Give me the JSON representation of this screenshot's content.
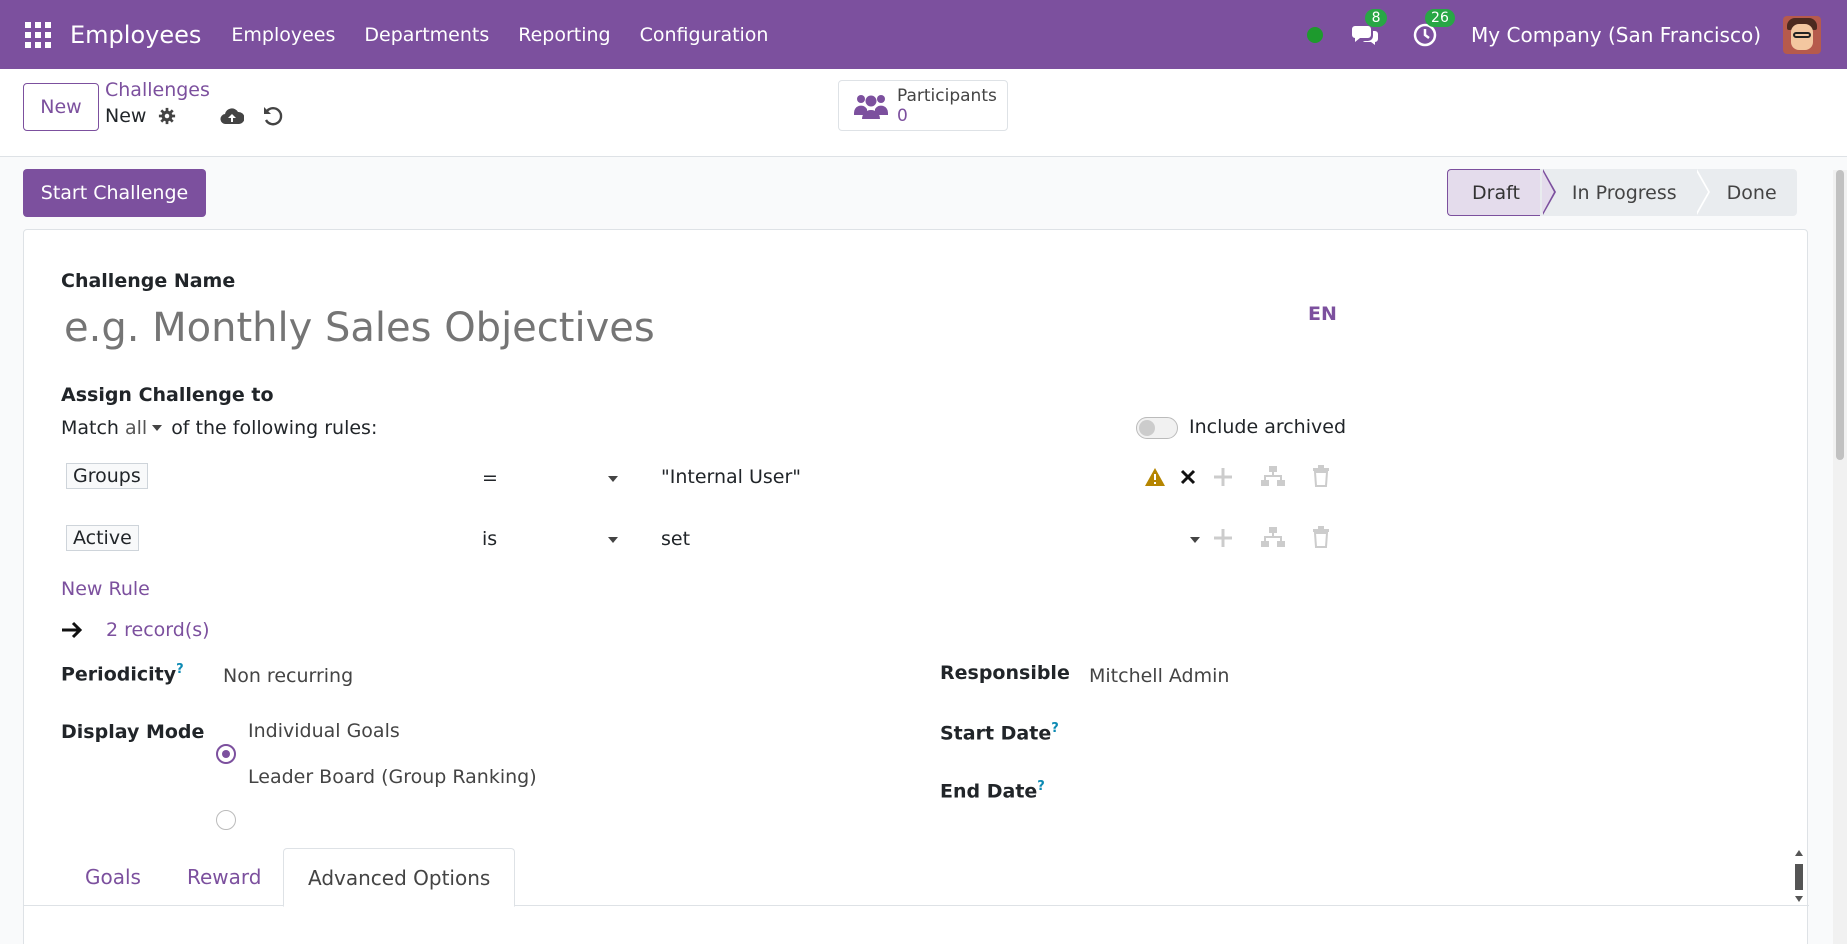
{
  "topbar": {
    "app_name": "Employees",
    "nav": [
      "Employees",
      "Departments",
      "Reporting",
      "Configuration"
    ],
    "messages_count": "8",
    "activities_count": "26",
    "company": "My Company (San Francisco)"
  },
  "control": {
    "new_label": "New",
    "breadcrumb_parent": "Challenges",
    "breadcrumb_current": "New",
    "participants_label": "Participants",
    "participants_count": "0"
  },
  "status": {
    "start_label": "Start Challenge",
    "stages": [
      "Draft",
      "In Progress",
      "Done"
    ],
    "active_stage": "Draft"
  },
  "form": {
    "challenge_name_label": "Challenge Name",
    "challenge_name_placeholder": "e.g. Monthly Sales Objectives",
    "lang": "EN",
    "assign_label": "Assign Challenge to",
    "match_prefix": "Match",
    "match_value": "all",
    "match_suffix": "of the following rules:",
    "include_archived": "Include archived",
    "rules": [
      {
        "field": "Groups",
        "operator": "=",
        "value": "\"Internal User\""
      },
      {
        "field": "Active",
        "operator": "is",
        "value": "set"
      }
    ],
    "new_rule": "New Rule",
    "records": "2 record(s)",
    "periodicity_label": "Periodicity",
    "periodicity_value": "Non recurring",
    "display_mode_label": "Display Mode",
    "display_options": [
      "Individual Goals",
      "Leader Board (Group Ranking)"
    ],
    "responsible_label": "Responsible",
    "responsible_value": "Mitchell Admin",
    "start_date_label": "Start Date",
    "end_date_label": "End Date",
    "help_mark": "?"
  },
  "tabs": [
    "Goals",
    "Reward",
    "Advanced Options"
  ],
  "colors": {
    "brand": "#7c509e",
    "badge": "#28a745",
    "warning": "#b58500"
  }
}
